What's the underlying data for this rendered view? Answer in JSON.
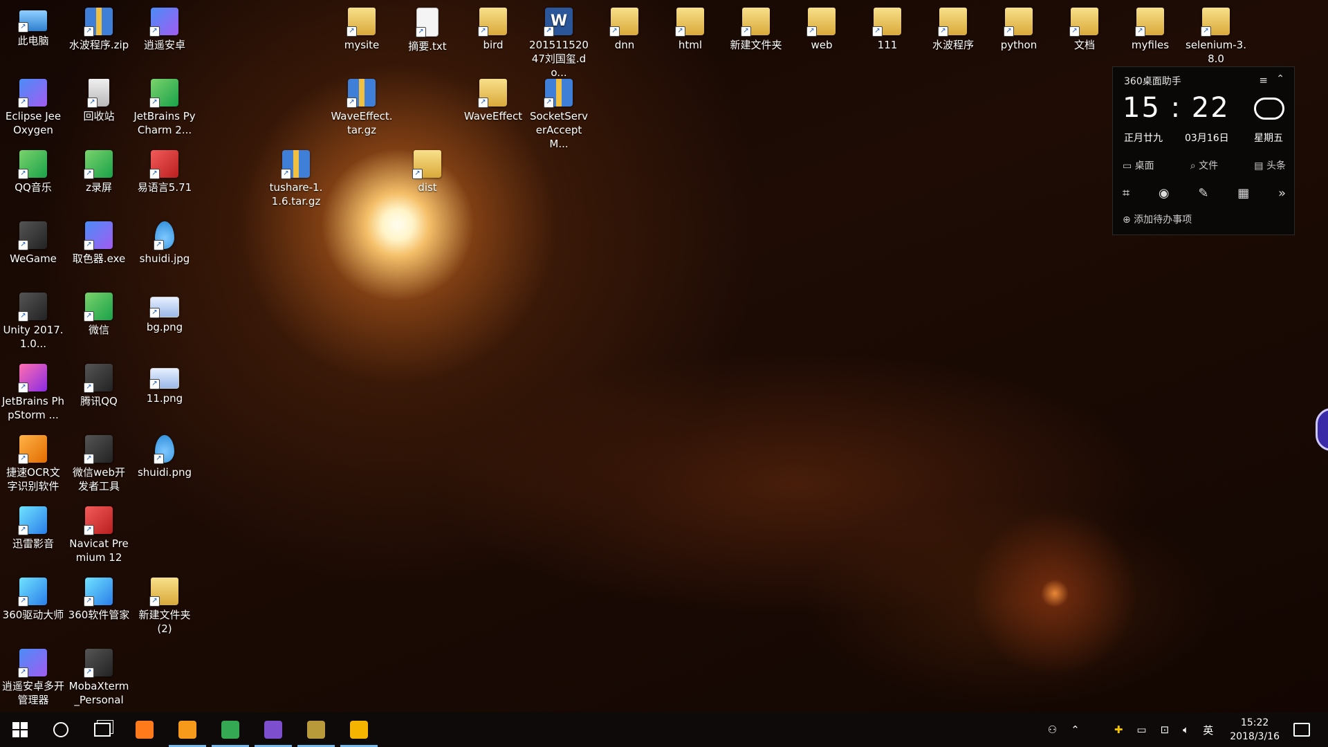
{
  "desktop": {
    "icons": [
      {
        "label": "此电脑",
        "col": 0,
        "row": 0,
        "kind": "pc",
        "icon": "computer-icon"
      },
      {
        "label": "Eclipse Jee Oxygen",
        "col": 0,
        "row": 1,
        "kind": "app",
        "icon": "eclipse-icon"
      },
      {
        "label": "QQ音乐",
        "col": 0,
        "row": 2,
        "kind": "green",
        "icon": "qq-music-icon"
      },
      {
        "label": "WeGame",
        "col": 0,
        "row": 3,
        "kind": "dark",
        "icon": "wegame-icon"
      },
      {
        "label": "Unity 2017.1.0...",
        "col": 0,
        "row": 4,
        "kind": "dark",
        "icon": "unity-icon"
      },
      {
        "label": "JetBrains PhpStorm ...",
        "col": 0,
        "row": 5,
        "kind": "pink",
        "icon": "phpstorm-icon"
      },
      {
        "label": "捷速OCR文字识别软件",
        "col": 0,
        "row": 6,
        "kind": "orange",
        "icon": "ocr-icon"
      },
      {
        "label": "迅雷影音",
        "col": 0,
        "row": 7,
        "kind": "cyan",
        "icon": "xunlei-icon"
      },
      {
        "label": "360驱动大师",
        "col": 0,
        "row": 8,
        "kind": "cyan",
        "icon": "driver-icon"
      },
      {
        "label": "逍遥安卓多开管理器",
        "col": 0,
        "row": 9,
        "kind": "app",
        "icon": "android-multi-icon"
      },
      {
        "label": "水波程序.zip",
        "col": 1,
        "row": 0,
        "kind": "zip",
        "icon": "zip-icon"
      },
      {
        "label": "回收站",
        "col": 1,
        "row": 1,
        "kind": "bin",
        "icon": "recycle-bin-icon"
      },
      {
        "label": "z录屏",
        "col": 1,
        "row": 2,
        "kind": "green",
        "icon": "recorder-icon"
      },
      {
        "label": "取色器.exe",
        "col": 1,
        "row": 3,
        "kind": "app",
        "icon": "color-picker-icon"
      },
      {
        "label": "微信",
        "col": 1,
        "row": 4,
        "kind": "green",
        "icon": "wechat-icon"
      },
      {
        "label": "腾讯QQ",
        "col": 1,
        "row": 5,
        "kind": "dark",
        "icon": "qq-icon"
      },
      {
        "label": "微信web开发者工具",
        "col": 1,
        "row": 6,
        "kind": "dark",
        "icon": "wechat-devtools-icon"
      },
      {
        "label": "Navicat Premium 12",
        "col": 1,
        "row": 7,
        "kind": "red",
        "icon": "navicat-icon"
      },
      {
        "label": "360软件管家",
        "col": 1,
        "row": 8,
        "kind": "cyan",
        "icon": "software-manager-icon"
      },
      {
        "label": "MobaXterm_Personal_...",
        "col": 1,
        "row": 9,
        "kind": "dark",
        "icon": "mobaxterm-icon"
      },
      {
        "label": "逍遥安卓",
        "col": 2,
        "row": 0,
        "kind": "app",
        "icon": "android-emulator-icon"
      },
      {
        "label": "JetBrains PyCharm 2...",
        "col": 2,
        "row": 1,
        "kind": "green",
        "icon": "pycharm-icon"
      },
      {
        "label": "易语言5.71",
        "col": 2,
        "row": 2,
        "kind": "red",
        "icon": "eyuyan-icon"
      },
      {
        "label": "shuidi.jpg",
        "col": 2,
        "row": 3,
        "kind": "drop",
        "icon": "image-file-icon"
      },
      {
        "label": "bg.png",
        "col": 2,
        "row": 4,
        "kind": "img",
        "icon": "image-file-icon"
      },
      {
        "label": "11.png",
        "col": 2,
        "row": 5,
        "kind": "img",
        "icon": "image-file-icon"
      },
      {
        "label": "shuidi.png",
        "col": 2,
        "row": 6,
        "kind": "drop",
        "icon": "image-file-icon"
      },
      {
        "label": "新建文件夹 (2)",
        "col": 2,
        "row": 8,
        "kind": "folder",
        "icon": "folder-icon"
      },
      {
        "label": "tushare-1.1.6.tar.gz",
        "col": 4,
        "row": 2,
        "kind": "zip",
        "icon": "archive-icon"
      },
      {
        "label": "mysite",
        "col": 5,
        "row": 0,
        "kind": "folder",
        "icon": "folder-icon"
      },
      {
        "label": "WaveEffect.tar.gz",
        "col": 5,
        "row": 1,
        "kind": "zip",
        "icon": "archive-icon"
      },
      {
        "label": "摘要.txt",
        "col": 6,
        "row": 0,
        "kind": "doc",
        "icon": "text-file-icon"
      },
      {
        "label": "dist",
        "col": 6,
        "row": 2,
        "kind": "folder",
        "icon": "folder-icon"
      },
      {
        "label": "bird",
        "col": 7,
        "row": 0,
        "kind": "folder",
        "icon": "folder-icon"
      },
      {
        "label": "WaveEffect",
        "col": 7,
        "row": 1,
        "kind": "folder",
        "icon": "folder-icon"
      },
      {
        "label": "20151152047刘国玺.do...",
        "col": 8,
        "row": 0,
        "kind": "word",
        "icon": "word-doc-icon"
      },
      {
        "label": "SocketServerAcceptM...",
        "col": 8,
        "row": 1,
        "kind": "zip",
        "icon": "archive-icon"
      },
      {
        "label": "dnn",
        "col": 9,
        "row": 0,
        "kind": "folder",
        "icon": "folder-icon"
      },
      {
        "label": "html",
        "col": 10,
        "row": 0,
        "kind": "folder",
        "icon": "folder-icon"
      },
      {
        "label": "新建文件夹",
        "col": 11,
        "row": 0,
        "kind": "folder",
        "icon": "folder-icon"
      },
      {
        "label": "web",
        "col": 12,
        "row": 0,
        "kind": "folder",
        "icon": "folder-icon"
      },
      {
        "label": "111",
        "col": 13,
        "row": 0,
        "kind": "folder",
        "icon": "folder-icon"
      },
      {
        "label": "水波程序",
        "col": 14,
        "row": 0,
        "kind": "folder",
        "icon": "folder-icon"
      },
      {
        "label": "python",
        "col": 15,
        "row": 0,
        "kind": "folder",
        "icon": "folder-icon"
      },
      {
        "label": "文档",
        "col": 16,
        "row": 0,
        "kind": "folder",
        "icon": "folder-icon"
      },
      {
        "label": "myfiles",
        "col": 17,
        "row": 0,
        "kind": "folder",
        "icon": "folder-icon"
      },
      {
        "label": "selenium-3.8.0",
        "col": 18,
        "row": 0,
        "kind": "folder",
        "icon": "folder-icon"
      }
    ]
  },
  "widget": {
    "title": "360桌面助手",
    "menu_icon": "menu-icon",
    "collapse_icon": "chevron-up-icon",
    "time": "15 : 22",
    "weather_icon": "cloud-icon",
    "lunar": "正月廿九",
    "date": "03月16日",
    "weekday": "星期五",
    "tabs": [
      {
        "label": "桌面",
        "icon": "monitor-icon",
        "glyph": "▭"
      },
      {
        "label": "文件",
        "icon": "search-icon",
        "glyph": "⌕"
      },
      {
        "label": "头条",
        "icon": "news-icon",
        "glyph": "▤"
      }
    ],
    "tools": [
      {
        "icon": "crop-icon",
        "glyph": "⌗"
      },
      {
        "icon": "eye-icon",
        "glyph": "◉"
      },
      {
        "icon": "note-icon",
        "glyph": "✎"
      },
      {
        "icon": "calculator-icon",
        "glyph": "▦"
      },
      {
        "icon": "more-icon",
        "glyph": "»"
      }
    ],
    "todo": "添加待办事项"
  },
  "taskbar": {
    "apps": [
      {
        "icon": "firefox-icon",
        "color": "#ff7a1a",
        "active": false
      },
      {
        "icon": "sublime-icon",
        "color": "#f59a1b",
        "active": true
      },
      {
        "icon": "chrome-icon",
        "color": "#34a853",
        "active": true
      },
      {
        "icon": "visual-studio-icon",
        "color": "#7d4fcf",
        "active": true
      },
      {
        "icon": "lol-icon",
        "color": "#b89a3a",
        "active": true
      },
      {
        "icon": "wegame-icon",
        "color": "#f5b400",
        "active": true
      }
    ],
    "tray": {
      "ime": "英",
      "time": "15:22",
      "date": "2018/3/16"
    }
  }
}
